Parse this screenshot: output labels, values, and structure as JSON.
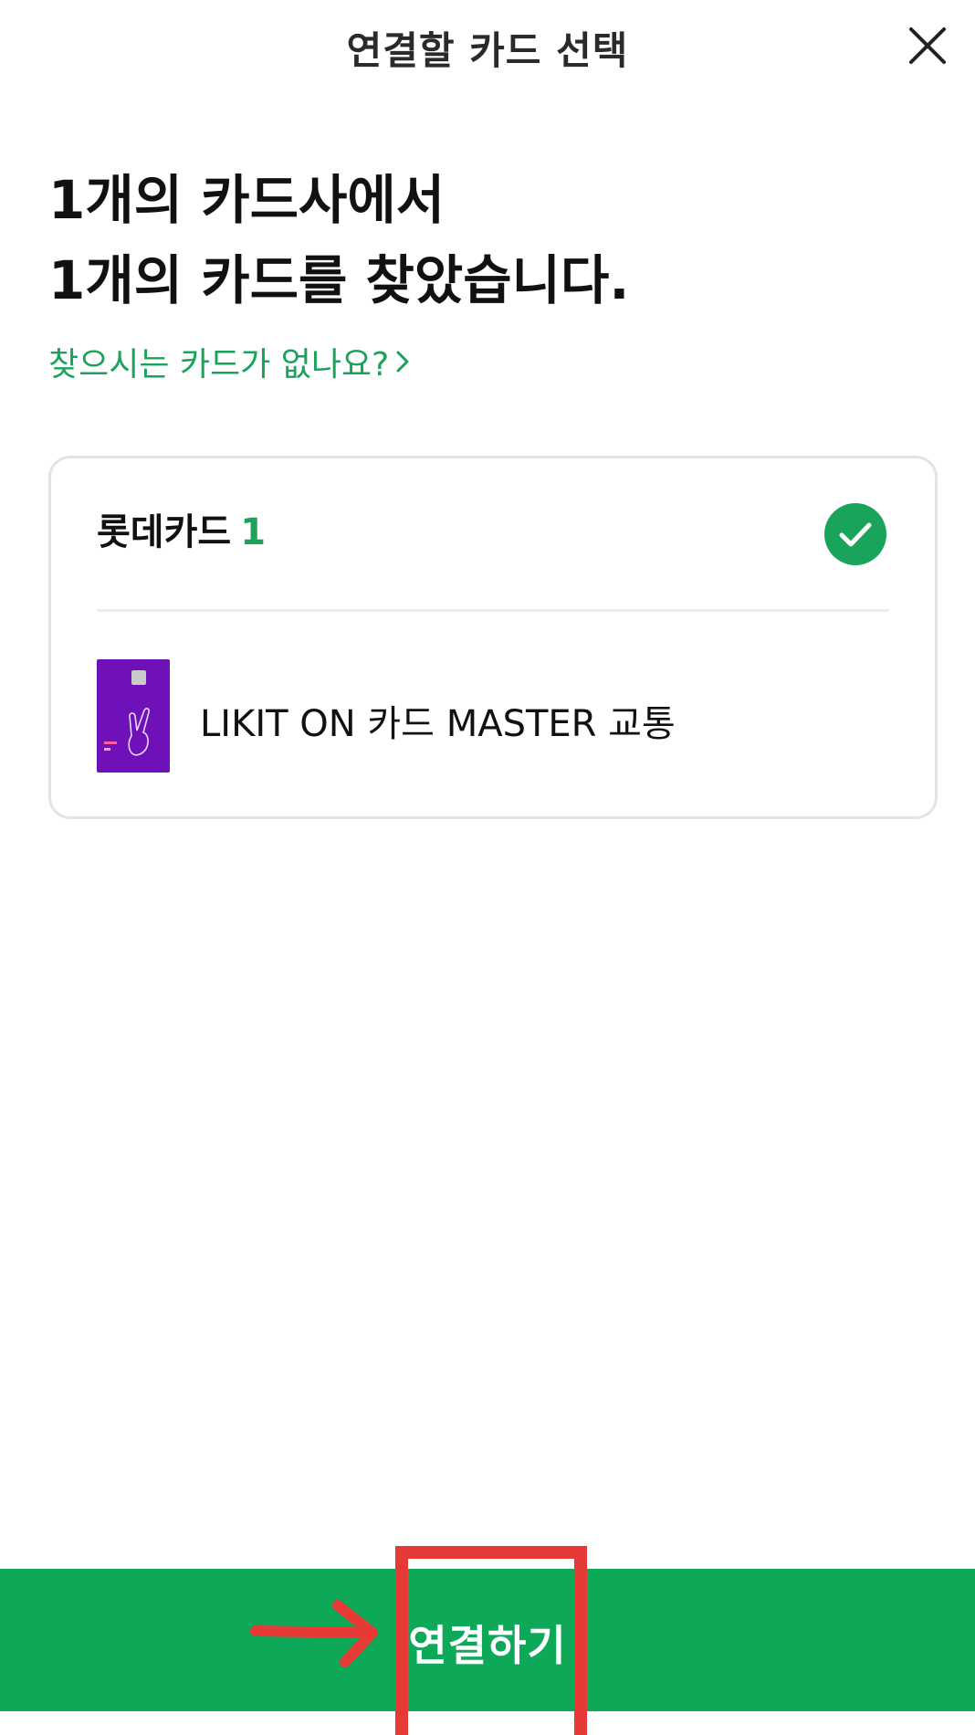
{
  "header": {
    "title": "연결할 카드 선택",
    "close_icon": "close-icon"
  },
  "headline": {
    "line1": "1개의 카드사에서",
    "line2": "1개의 카드를 찾았습니다."
  },
  "help_link": {
    "label": "찾으시는 카드가 없나요?",
    "icon": "chevron-right-icon"
  },
  "issuer": {
    "name": "롯데카드",
    "count": "1",
    "selected": true,
    "check_icon": "check-circle-icon"
  },
  "cards": [
    {
      "name": "LIKIT ON 카드 MASTER 교통",
      "thumbnail_color": "#6e11b8"
    }
  ],
  "bottom_button": {
    "label": "연결하기"
  },
  "annotation": {
    "highlight_color": "#e53a35",
    "arrow_icon": "arrow-right-icon"
  },
  "colors": {
    "accent": "#1aa35a",
    "button_bg": "#0ea958",
    "highlight": "#e53a35"
  }
}
